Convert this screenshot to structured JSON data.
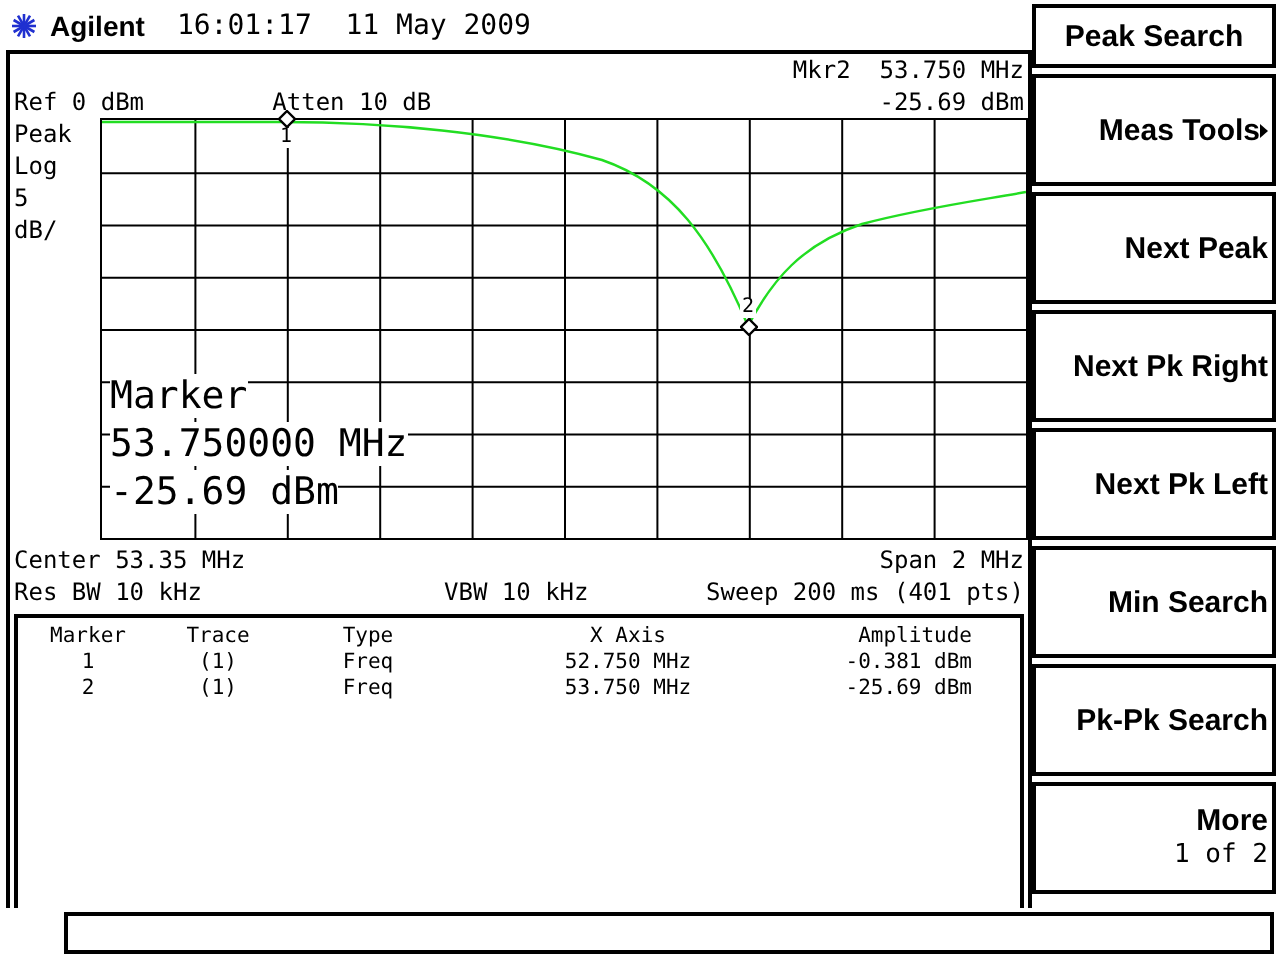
{
  "header": {
    "brand": "Agilent",
    "datetime": "16:01:17  11 May 2009"
  },
  "display": {
    "marker_readout": "Mkr2  53.750 MHz",
    "reference": "Ref 0 dBm",
    "attenuation": "Atten 10 dB",
    "marker_amplitude": "-25.69 dBm",
    "scale_labels": [
      "Peak",
      "Log",
      "5",
      "dB/"
    ],
    "trace_markers": [
      {
        "label": "1"
      },
      {
        "label": "2"
      }
    ],
    "marker_overlay": [
      "Marker",
      "53.750000 MHz",
      "-25.69 dBm"
    ],
    "center": "Center 53.35 MHz",
    "span": "Span 2 MHz",
    "res_bw": "Res BW 10 kHz",
    "vbw": "VBW 10 kHz",
    "sweep": "Sweep 200 ms (401 pts)"
  },
  "marker_table": {
    "columns": [
      "Marker",
      "Trace",
      "Type",
      "X Axis",
      "Amplitude"
    ],
    "rows": [
      [
        "1",
        "(1)",
        "Freq",
        "52.750 MHz",
        "-0.381 dBm"
      ],
      [
        "2",
        "(1)",
        "Freq",
        "53.750 MHz",
        "-25.69 dBm"
      ]
    ]
  },
  "softkeys": {
    "title": "Peak Search",
    "keys": [
      {
        "label": "Meas Tools",
        "submenu": true
      },
      {
        "label": "Next Peak",
        "submenu": false
      },
      {
        "label": "Next Pk Right",
        "submenu": false
      },
      {
        "label": "Next Pk Left",
        "submenu": false
      },
      {
        "label": "Min Search",
        "submenu": false
      },
      {
        "label": "Pk-Pk Search",
        "submenu": false
      },
      {
        "label": "More",
        "submenu": false,
        "sublabel": "1 of 2"
      }
    ]
  }
}
